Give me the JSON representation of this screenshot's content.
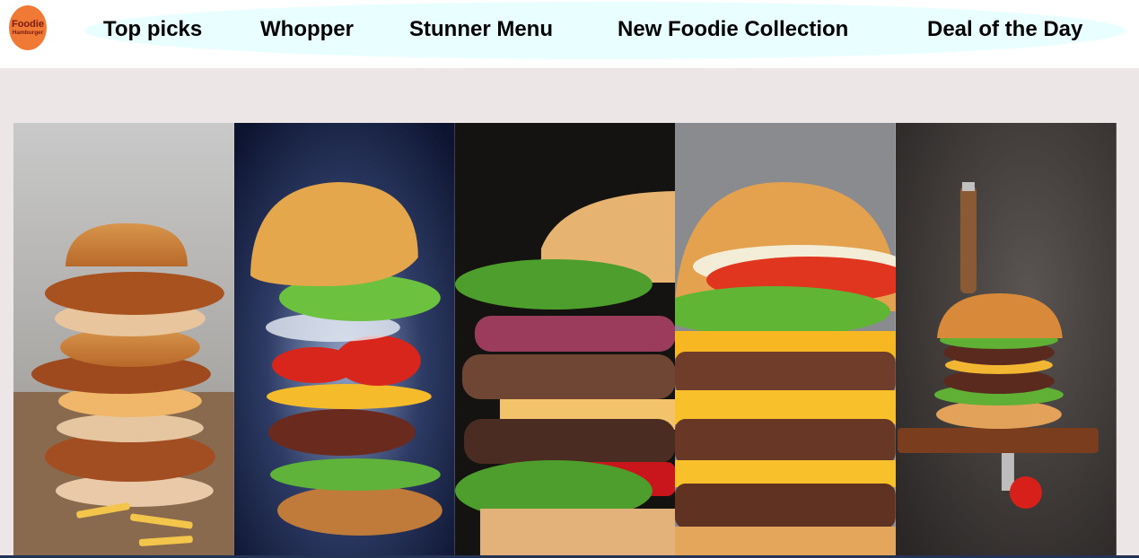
{
  "logo": {
    "main": "Foodie",
    "sub": "Hamburger"
  },
  "nav": [
    {
      "label": "Top picks"
    },
    {
      "label": "Whopper"
    },
    {
      "label": "Stunner Menu"
    },
    {
      "label": "New Foodie Collection"
    },
    {
      "label": "Deal of the Day"
    }
  ],
  "colors": {
    "header_bg": "#ffffff",
    "nav_pill": "#e8feff",
    "page_bg": "#ece6e6",
    "logo_bg": "#f07a35",
    "logo_text": "#7a1a10"
  },
  "gallery": [
    {
      "image": "stacked-fried-chicken-burger-with-fries"
    },
    {
      "image": "floating-exploded-burger-on-blue"
    },
    {
      "image": "double-patty-burger-closeup-dark"
    },
    {
      "image": "triple-cheeseburger-closeup"
    },
    {
      "image": "burger-on-board-with-knife-dark"
    }
  ]
}
